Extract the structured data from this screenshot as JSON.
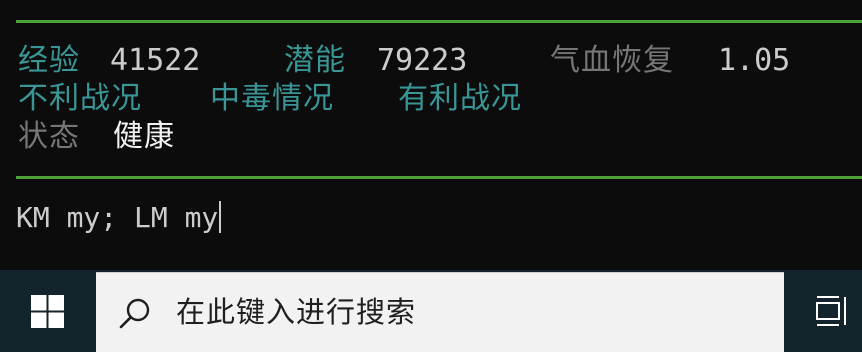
{
  "terminal": {
    "stats": {
      "exp_label": "经验",
      "exp_value": "41522",
      "potential_label": "潜能",
      "potential_value": "79223",
      "hp_recovery_label": "气血恢复",
      "hp_recovery_value": "1.05"
    },
    "conditions": {
      "unfavorable": "不利战况",
      "poisoned": "中毒情况",
      "favorable": "有利战况"
    },
    "state": {
      "label": "状态",
      "value": "健康"
    },
    "command_input": "KM my; LM my",
    "colors": {
      "rule": "#4fa23a",
      "teal": "#3a9696",
      "gray": "#767676",
      "text": "#cccccc"
    }
  },
  "taskbar": {
    "start_icon": "windows-logo-icon",
    "search_icon": "search-icon",
    "search_placeholder": "在此键入进行搜索",
    "task_view_icon": "task-view-icon",
    "background": "#14242c"
  }
}
